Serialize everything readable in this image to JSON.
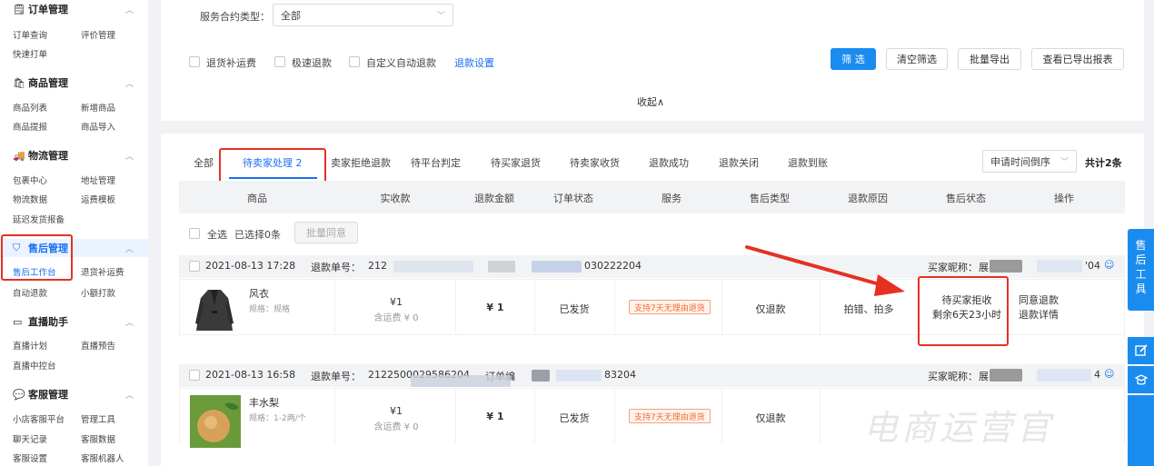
{
  "sidebar": {
    "sections": [
      {
        "icon": "clipboard-icon",
        "glyph": "🗒",
        "title": "订单管理",
        "items": [
          "订单查询",
          "评价管理",
          "快速打单"
        ]
      },
      {
        "icon": "bag-icon",
        "glyph": "🛍",
        "title": "商品管理",
        "items": [
          "商品列表",
          "新增商品",
          "商品提报",
          "商品导入"
        ]
      },
      {
        "icon": "truck-icon",
        "glyph": "🚚",
        "title": "物流管理",
        "items": [
          "包裹中心",
          "地址管理",
          "物流数据",
          "运费模板",
          "延迟发货报备"
        ]
      },
      {
        "icon": "shield-icon",
        "glyph": "⛉",
        "title": "售后管理",
        "items": [
          "售后工作台",
          "退货补运费",
          "自动退款",
          "小额打款"
        ],
        "active": true
      },
      {
        "icon": "video-icon",
        "glyph": "▭",
        "title": "直播助手",
        "items": [
          "直播计划",
          "直播预告",
          "直播中控台"
        ]
      },
      {
        "icon": "chat-icon",
        "glyph": "💬",
        "title": "客服管理",
        "items": [
          "小店客服平台",
          "管理工具",
          "聊天记录",
          "客服数据",
          "客服设置",
          "客服机器人"
        ]
      }
    ]
  },
  "filter": {
    "service_label": "服务合约类型：",
    "service_value": "全部",
    "options": [
      "退货补运费",
      "极速退款",
      "自定义自动退款"
    ],
    "refund_settings_link": "退款设置",
    "buttons": [
      "筛 选",
      "清空筛选",
      "批量导出",
      "查看已导出报表"
    ],
    "collapse": "收起∧"
  },
  "tabs": [
    "全部",
    "待卖家处理 2",
    "卖家拒绝退款",
    "待平台判定",
    "待买家退货",
    "待卖家收货",
    "退款成功",
    "退款关闭",
    "退款到账"
  ],
  "active_tab": 1,
  "sort_select": "申请时间倒序",
  "total": "共计2条",
  "columns": [
    "商品",
    "实收款",
    "退款金额",
    "订单状态",
    "服务",
    "售后类型",
    "退款原因",
    "售后状态",
    "操作"
  ],
  "bulk": {
    "select_all": "全选",
    "selected": "已选择0条",
    "batch_agree": "批量同意"
  },
  "orders": [
    {
      "date": "2021-08-13 17:28",
      "refund_no_label": "退款单号：",
      "refund_no_prefix": "212",
      "refund_no_suffix": "030222204",
      "buyer_label": "买家昵称：",
      "buyer_name": "展",
      "buyer_suffix": "'04",
      "product_name": "风衣",
      "spec": "规格：规格",
      "paid": "¥1",
      "shipping": "含运费 ¥ 0",
      "refund_amount": "¥ 1",
      "order_status": "已发货",
      "service": "支持7天无理由退货",
      "aftersale_type": "仅退款",
      "reason": "拍错、拍多",
      "status_line1": "待买家拒收",
      "status_line2": "剩余6天23小时",
      "actions": [
        "同意退款",
        "退款详情"
      ]
    },
    {
      "date": "2021-08-13 16:58",
      "refund_no_label": "退款单号：",
      "refund_no_prefix": "2122500029586204",
      "refund_no_suffix": "83204",
      "order_label": "订单编",
      "buyer_label": "买家昵称：",
      "buyer_name": "展",
      "buyer_suffix": "4",
      "product_name": "丰水梨",
      "spec": "规格：1-2两/个",
      "paid": "¥1",
      "shipping": "含运费 ¥ 0",
      "refund_amount": "¥ 1",
      "order_status": "已发货",
      "service": "支持7天无理由退货",
      "aftersale_type": "仅退款"
    }
  ],
  "float_tool": "售后工具",
  "watermark": "电商运营官"
}
